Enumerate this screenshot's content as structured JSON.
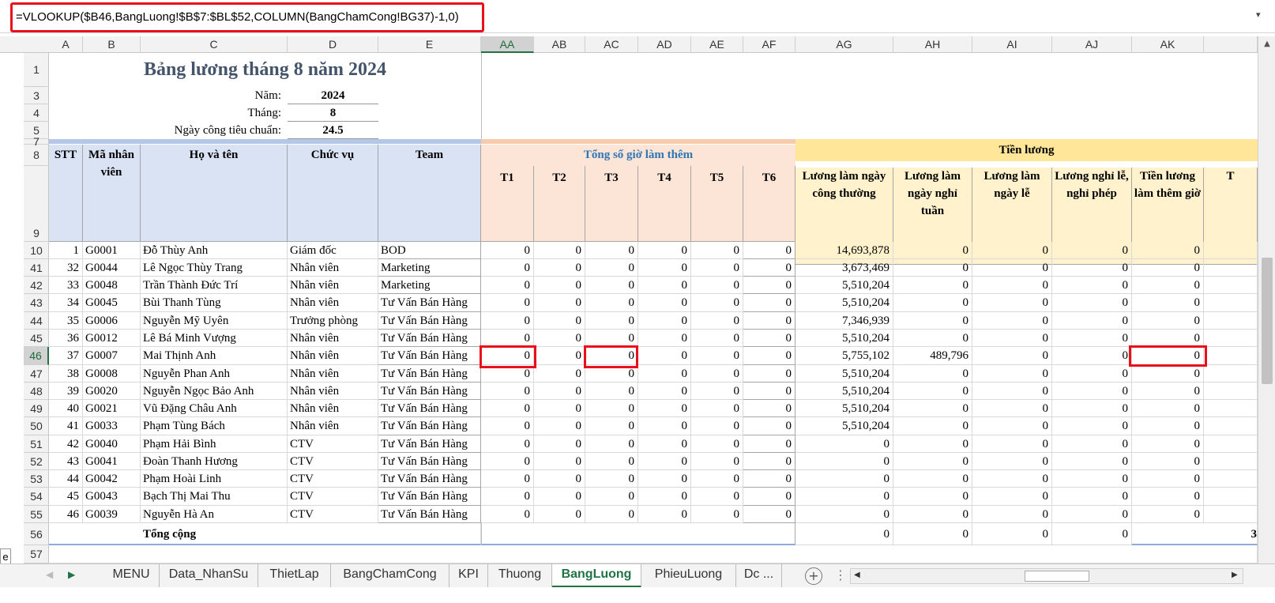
{
  "formula_bar": {
    "formula": "=VLOOKUP($B46,BangLuong!$B$7:$BL$52,COLUMN(BangChamCong!BG37)-1,0)",
    "dropdown_icon": "chevron-down-icon"
  },
  "columns": [
    {
      "label": "A"
    },
    {
      "label": "B"
    },
    {
      "label": "C"
    },
    {
      "label": "D"
    },
    {
      "label": "E"
    },
    {
      "label": "AA"
    },
    {
      "label": "AB"
    },
    {
      "label": "AC"
    },
    {
      "label": "AD"
    },
    {
      "label": "AE"
    },
    {
      "label": "AF"
    },
    {
      "label": "AG"
    },
    {
      "label": "AH"
    },
    {
      "label": "AI"
    },
    {
      "label": "AJ"
    },
    {
      "label": "AK"
    },
    {
      "label": ""
    }
  ],
  "selected_column": "AA",
  "selected_row": "46",
  "rows": [
    {
      "label": "1"
    },
    {
      "label": "3"
    },
    {
      "label": "4"
    },
    {
      "label": "5"
    },
    {
      "label": "7"
    },
    {
      "label": "8"
    },
    {
      "label": "9"
    },
    {
      "label": "10"
    },
    {
      "label": "41"
    },
    {
      "label": "42"
    },
    {
      "label": "43"
    },
    {
      "label": "44"
    },
    {
      "label": "45"
    },
    {
      "label": "46"
    },
    {
      "label": "47"
    },
    {
      "label": "48"
    },
    {
      "label": "49"
    },
    {
      "label": "50"
    },
    {
      "label": "51"
    },
    {
      "label": "52"
    },
    {
      "label": "53"
    },
    {
      "label": "54"
    },
    {
      "label": "55"
    },
    {
      "label": "56"
    },
    {
      "label": "57"
    }
  ],
  "sheet": {
    "title": "Bảng lương tháng 8 năm 2024",
    "year_label": "Năm:",
    "year_value": "2024",
    "month_label": "Tháng:",
    "month_value": "8",
    "workdays_label": "Ngày công tiêu chuẩn:",
    "workdays_value": "24.5",
    "salary_group": "Tiền lương",
    "overtime_group": "Tổng số giờ làm thêm",
    "headers": {
      "stt": "STT",
      "ma_nv": "Mã nhân viên",
      "ho_ten": "Họ và tên",
      "chuc_vu": "Chức vụ",
      "team": "Team",
      "t1": "T1",
      "t2": "T2",
      "t3": "T3",
      "t4": "T4",
      "t5": "T5",
      "t6": "T6",
      "ag": "Lương làm ngày công thường",
      "ah": "Lương làm ngày nghỉ tuần",
      "ai": "Lương làm ngày lễ",
      "aj": "Lương nghỉ lễ, nghỉ phép",
      "ak": "Tiền lương làm thêm giờ",
      "al": "T"
    },
    "data_rows": [
      {
        "stt": "1",
        "ma": "G0001",
        "ten": "Đỗ Thùy Anh",
        "cv": "Giám đốc",
        "team": "BOD",
        "t1": "0",
        "t2": "0",
        "t3": "0",
        "t4": "0",
        "t5": "0",
        "t6": "0",
        "ag": "14,693,878",
        "ah": "0",
        "ai": "0",
        "aj": "0",
        "ak": "0"
      },
      {
        "stt": "32",
        "ma": "G0044",
        "ten": "Lê Ngọc Thùy Trang",
        "cv": "Nhân viên",
        "team": "Marketing",
        "t1": "0",
        "t2": "0",
        "t3": "0",
        "t4": "0",
        "t5": "0",
        "t6": "0",
        "ag": "3,673,469",
        "ah": "0",
        "ai": "0",
        "aj": "0",
        "ak": "0"
      },
      {
        "stt": "33",
        "ma": "G0048",
        "ten": "Trần Thành Đức Trí",
        "cv": "Nhân viên",
        "team": "Marketing",
        "t1": "0",
        "t2": "0",
        "t3": "0",
        "t4": "0",
        "t5": "0",
        "t6": "0",
        "ag": "5,510,204",
        "ah": "0",
        "ai": "0",
        "aj": "0",
        "ak": "0"
      },
      {
        "stt": "34",
        "ma": "G0045",
        "ten": "Bùi Thanh Tùng",
        "cv": "Nhân viên",
        "team": "Tư Vấn Bán Hàng",
        "t1": "0",
        "t2": "0",
        "t3": "0",
        "t4": "0",
        "t5": "0",
        "t6": "0",
        "ag": "5,510,204",
        "ah": "0",
        "ai": "0",
        "aj": "0",
        "ak": "0"
      },
      {
        "stt": "35",
        "ma": "G0006",
        "ten": "Nguyễn Mỹ Uyên",
        "cv": "Trưởng phòng",
        "team": "Tư Vấn Bán Hàng",
        "t1": "0",
        "t2": "0",
        "t3": "0",
        "t4": "0",
        "t5": "0",
        "t6": "0",
        "ag": "7,346,939",
        "ah": "0",
        "ai": "0",
        "aj": "0",
        "ak": "0"
      },
      {
        "stt": "36",
        "ma": "G0012",
        "ten": "Lê Bá Minh Vượng",
        "cv": "Nhân viên",
        "team": "Tư Vấn Bán Hàng",
        "t1": "0",
        "t2": "0",
        "t3": "0",
        "t4": "0",
        "t5": "0",
        "t6": "0",
        "ag": "5,510,204",
        "ah": "0",
        "ai": "0",
        "aj": "0",
        "ak": "0"
      },
      {
        "stt": "37",
        "ma": "G0007",
        "ten": "Mai Thịnh Anh",
        "cv": "Nhân viên",
        "team": "Tư Vấn Bán Hàng",
        "t1": "0",
        "t2": "0",
        "t3": "0",
        "t4": "0",
        "t5": "0",
        "t6": "0",
        "ag": "5,755,102",
        "ah": "489,796",
        "ai": "0",
        "aj": "0",
        "ak": "0"
      },
      {
        "stt": "38",
        "ma": "G0008",
        "ten": "Nguyễn Phan Anh",
        "cv": "Nhân viên",
        "team": "Tư Vấn Bán Hàng",
        "t1": "0",
        "t2": "0",
        "t3": "0",
        "t4": "0",
        "t5": "0",
        "t6": "0",
        "ag": "5,510,204",
        "ah": "0",
        "ai": "0",
        "aj": "0",
        "ak": "0"
      },
      {
        "stt": "39",
        "ma": "G0020",
        "ten": "Nguyễn Ngọc Bảo Anh",
        "cv": "Nhân viên",
        "team": "Tư Vấn Bán Hàng",
        "t1": "0",
        "t2": "0",
        "t3": "0",
        "t4": "0",
        "t5": "0",
        "t6": "0",
        "ag": "5,510,204",
        "ah": "0",
        "ai": "0",
        "aj": "0",
        "ak": "0"
      },
      {
        "stt": "40",
        "ma": "G0021",
        "ten": "Vũ Đặng Châu Anh",
        "cv": "Nhân viên",
        "team": "Tư Vấn Bán Hàng",
        "t1": "0",
        "t2": "0",
        "t3": "0",
        "t4": "0",
        "t5": "0",
        "t6": "0",
        "ag": "5,510,204",
        "ah": "0",
        "ai": "0",
        "aj": "0",
        "ak": "0"
      },
      {
        "stt": "41",
        "ma": "G0033",
        "ten": "Phạm Tùng Bách",
        "cv": "Nhân viên",
        "team": "Tư Vấn Bán Hàng",
        "t1": "0",
        "t2": "0",
        "t3": "0",
        "t4": "0",
        "t5": "0",
        "t6": "0",
        "ag": "5,510,204",
        "ah": "0",
        "ai": "0",
        "aj": "0",
        "ak": "0"
      },
      {
        "stt": "42",
        "ma": "G0040",
        "ten": "Phạm Hải Bình",
        "cv": "CTV",
        "team": "Tư Vấn Bán Hàng",
        "t1": "0",
        "t2": "0",
        "t3": "0",
        "t4": "0",
        "t5": "0",
        "t6": "0",
        "ag": "0",
        "ah": "0",
        "ai": "0",
        "aj": "0",
        "ak": "0"
      },
      {
        "stt": "43",
        "ma": "G0041",
        "ten": "Đoàn Thanh Hương",
        "cv": "CTV",
        "team": "Tư Vấn Bán Hàng",
        "t1": "0",
        "t2": "0",
        "t3": "0",
        "t4": "0",
        "t5": "0",
        "t6": "0",
        "ag": "0",
        "ah": "0",
        "ai": "0",
        "aj": "0",
        "ak": "0"
      },
      {
        "stt": "44",
        "ma": "G0042",
        "ten": "Phạm Hoài Linh",
        "cv": "CTV",
        "team": "Tư Vấn Bán Hàng",
        "t1": "0",
        "t2": "0",
        "t3": "0",
        "t4": "0",
        "t5": "0",
        "t6": "0",
        "ag": "0",
        "ah": "0",
        "ai": "0",
        "aj": "0",
        "ak": "0"
      },
      {
        "stt": "45",
        "ma": "G0043",
        "ten": "Bạch Thị Mai Thu",
        "cv": "CTV",
        "team": "Tư Vấn Bán Hàng",
        "t1": "0",
        "t2": "0",
        "t3": "0",
        "t4": "0",
        "t5": "0",
        "t6": "0",
        "ag": "0",
        "ah": "0",
        "ai": "0",
        "aj": "0",
        "ak": "0"
      },
      {
        "stt": "46",
        "ma": "G0039",
        "ten": "Nguyễn Hà An",
        "cv": "CTV",
        "team": "Tư Vấn Bán Hàng",
        "t1": "0",
        "t2": "0",
        "t3": "0",
        "t4": "0",
        "t5": "0",
        "t6": "0",
        "ag": "0",
        "ah": "0",
        "ai": "0",
        "aj": "0",
        "ak": "0"
      }
    ],
    "total_label": "Tổng cộng",
    "totals": {
      "ag": "0",
      "ah": "0",
      "ai": "0",
      "aj": "0",
      "ak": "3"
    }
  },
  "tabs": [
    {
      "label": "MENU"
    },
    {
      "label": "Data_NhanSu"
    },
    {
      "label": "ThietLap"
    },
    {
      "label": "BangChamCong"
    },
    {
      "label": "KPI"
    },
    {
      "label": "Thuong"
    },
    {
      "label": "BangLuong",
      "active": true
    },
    {
      "label": "PhieuLuong"
    },
    {
      "label": "Dc ..."
    }
  ],
  "tab_nav": {
    "prev_icon": "triangle-left-icon",
    "next_icon": "triangle-right-icon",
    "add_icon": "plus-circle-icon",
    "more_icon": "vertical-dots-icon"
  },
  "colors": {
    "accent": "#217346",
    "highlight": "#e8101a",
    "title": "#44546a",
    "blue_band": "#b4c7e7",
    "orange_band": "#f8cbad",
    "yellow_band": "#ffe699",
    "header_blue": "#dae3f3",
    "header_orange": "#fce4d6",
    "header_yellow": "#fff2cc",
    "overtime_text": "#2e75b6"
  }
}
